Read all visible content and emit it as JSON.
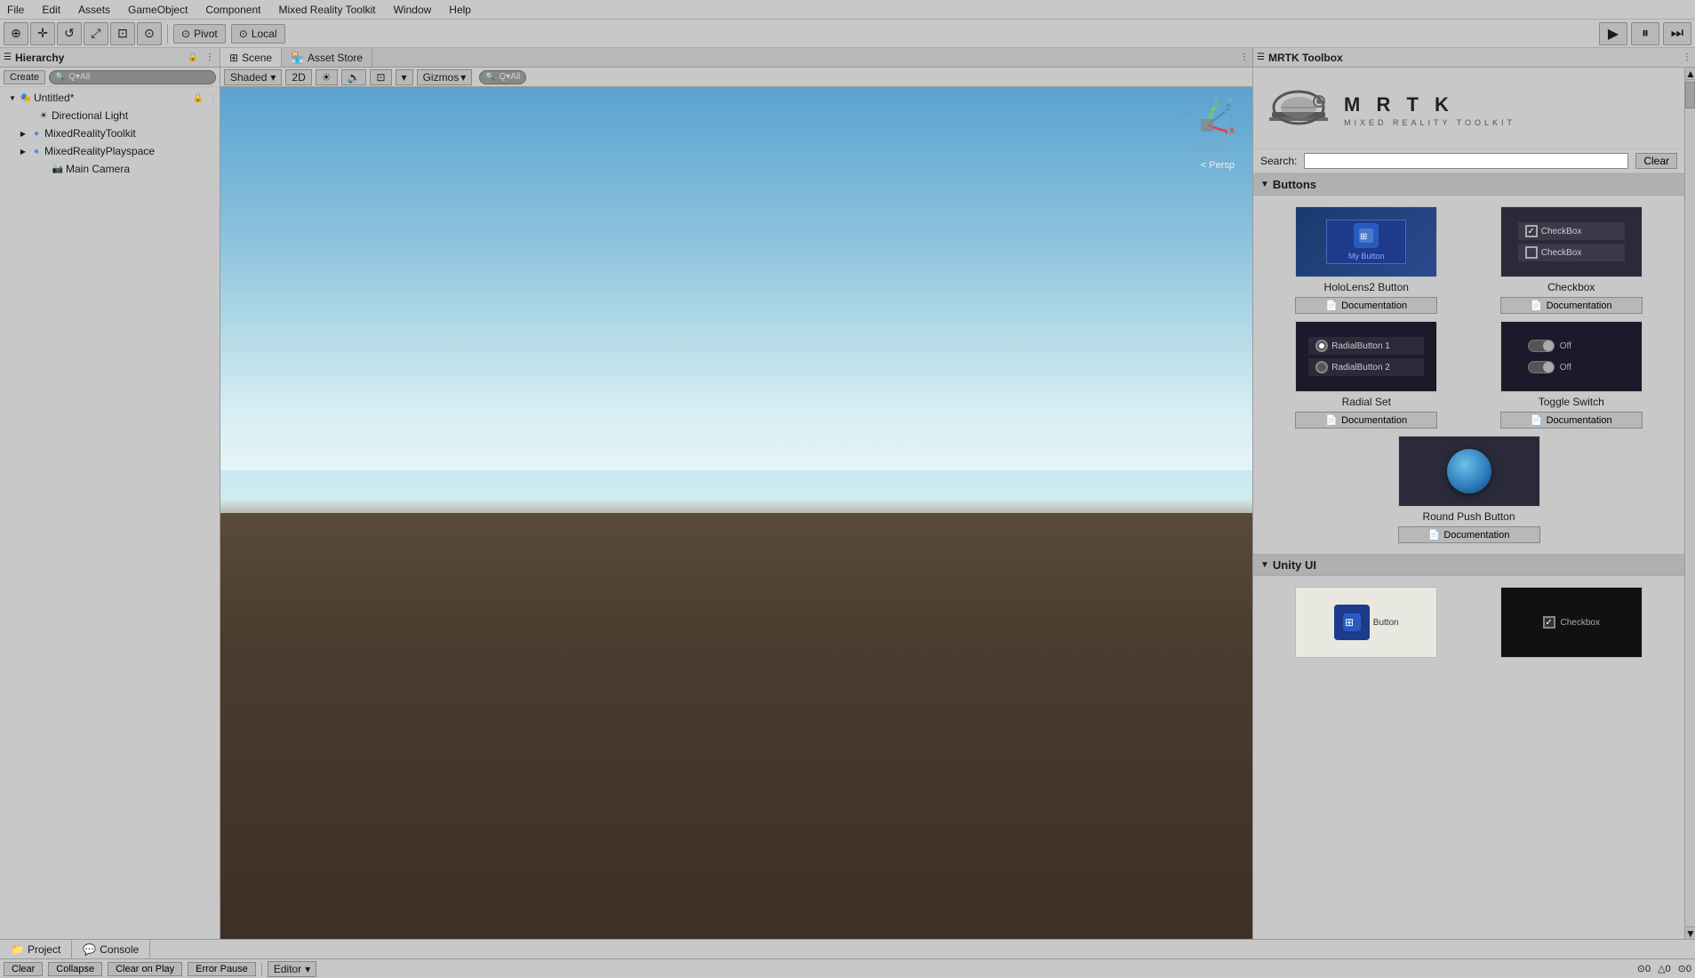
{
  "menu": {
    "items": [
      "File",
      "Edit",
      "Assets",
      "GameObject",
      "Component",
      "Mixed Reality Toolkit",
      "Window",
      "Help"
    ]
  },
  "toolbar": {
    "buttons": [
      "⊕",
      "✛",
      "↺",
      "⤢",
      "⊡",
      "⊙"
    ],
    "pivot_label": "Pivot",
    "local_label": "Local",
    "play_icon": "▶"
  },
  "hierarchy": {
    "title": "Hierarchy",
    "create_label": "Create",
    "search_placeholder": "Q-All",
    "lock_icon": "🔒",
    "items": [
      {
        "label": "Untitled*",
        "level": 0,
        "arrow": "▼",
        "icon": "🎭"
      },
      {
        "label": "Directional Light",
        "level": 1,
        "arrow": "",
        "icon": "☀"
      },
      {
        "label": "MixedRealityToolkit",
        "level": 1,
        "arrow": "▶",
        "icon": "🔵"
      },
      {
        "label": "MixedRealityPlayspace",
        "level": 1,
        "arrow": "▶",
        "icon": "🔵"
      },
      {
        "label": "Main Camera",
        "level": 2,
        "arrow": "",
        "icon": "📷"
      }
    ]
  },
  "scene": {
    "tabs": [
      {
        "label": "Scene",
        "icon": "⊞",
        "active": true
      },
      {
        "label": "Asset Store",
        "icon": "🏪",
        "active": false
      }
    ],
    "shaded": "Shaded",
    "mode_2d": "2D",
    "gizmos": "Gizmos",
    "search_placeholder": "Q-All",
    "persp_label": "< Persp"
  },
  "mrtk": {
    "panel_title": "MRTK Toolbox",
    "logo_title": "M R T K",
    "logo_subtitle": "MIXED REALITY TOOLKIT",
    "search_label": "Search:",
    "search_placeholder": "",
    "clear_label": "Clear",
    "sections": [
      {
        "title": "Buttons",
        "items": [
          {
            "label": "HoloLens2 Button",
            "doc_label": "Documentation",
            "type": "hololens"
          },
          {
            "label": "Checkbox",
            "doc_label": "Documentation",
            "type": "checkbox"
          },
          {
            "label": "Radial Set",
            "doc_label": "Documentation",
            "type": "radial"
          },
          {
            "label": "Toggle Switch",
            "doc_label": "Documentation",
            "type": "toggle"
          }
        ],
        "center_item": {
          "label": "Round Push Button",
          "doc_label": "Documentation",
          "type": "roundpush"
        }
      },
      {
        "title": "Unity UI",
        "items": [
          {
            "label": "",
            "doc_label": "",
            "type": "unity-button"
          },
          {
            "label": "",
            "doc_label": "",
            "type": "unity-checkbox"
          }
        ]
      }
    ]
  },
  "bottom_tabs": [
    {
      "label": "Project",
      "icon": "📁",
      "active": false
    },
    {
      "label": "Console",
      "icon": "💬",
      "active": true
    }
  ],
  "console": {
    "buttons": [
      "Clear",
      "Collapse",
      "Clear on Play",
      "Error Pause"
    ],
    "editor_label": "Editor",
    "right_icons": [
      "⊙",
      "△",
      "⊙"
    ]
  }
}
